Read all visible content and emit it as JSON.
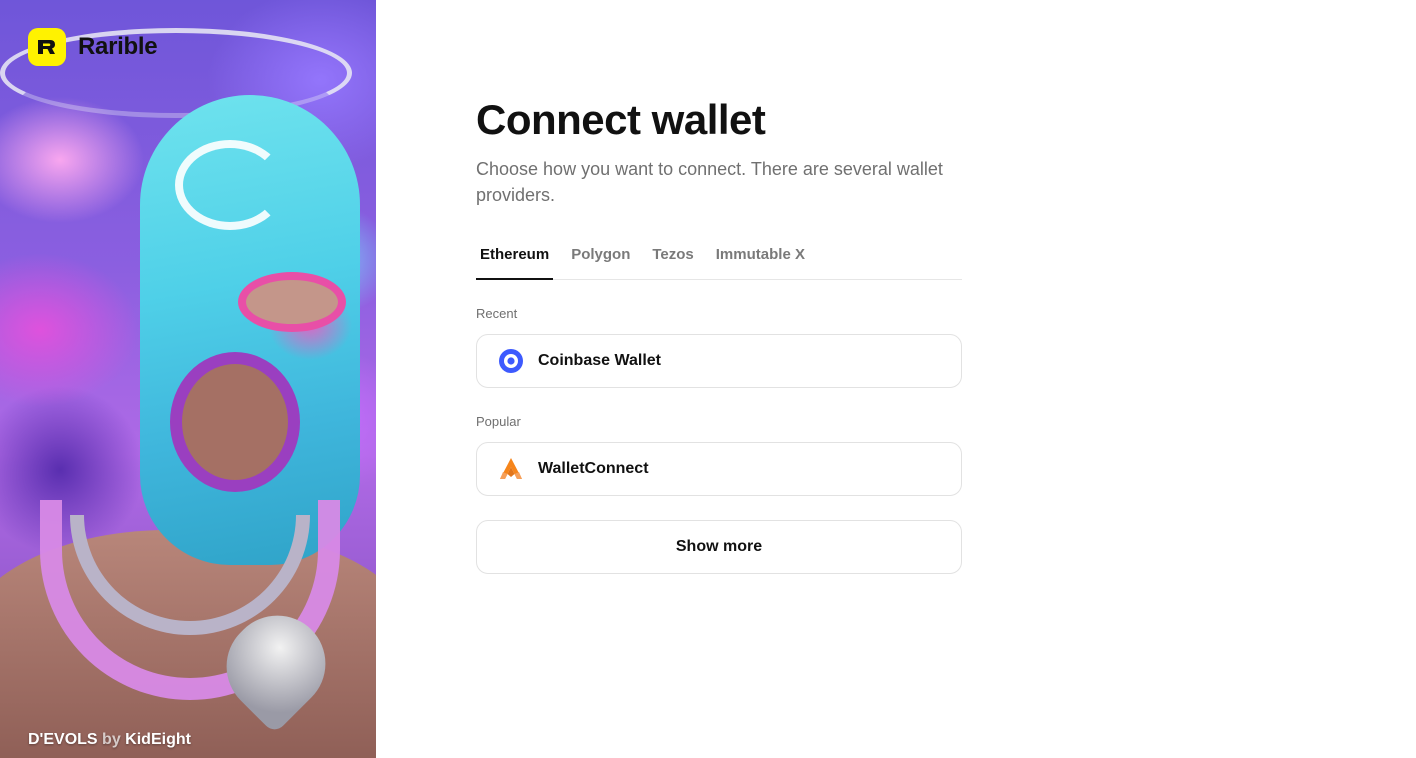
{
  "brand": {
    "name": "Rarible",
    "logo_color": "#fff200"
  },
  "artwork": {
    "credit_title": "D'EVOLS",
    "credit_by": "by",
    "credit_artist": "KidEight"
  },
  "header": {
    "title": "Connect wallet",
    "subtitle": "Choose how you want to connect. There are several wallet providers."
  },
  "tabs": [
    {
      "label": "Ethereum",
      "active": true
    },
    {
      "label": "Polygon",
      "active": false
    },
    {
      "label": "Tezos",
      "active": false
    },
    {
      "label": "Immutable X",
      "active": false
    }
  ],
  "sections": {
    "recent": {
      "label": "Recent",
      "wallets": [
        {
          "name": "Coinbase Wallet",
          "icon": "coinbase-icon",
          "color": "#3d5afe"
        }
      ]
    },
    "popular": {
      "label": "Popular",
      "wallets": [
        {
          "name": "WalletConnect",
          "icon": "walletconnect-icon",
          "color": "#f6851b"
        }
      ]
    }
  },
  "show_more_label": "Show more"
}
